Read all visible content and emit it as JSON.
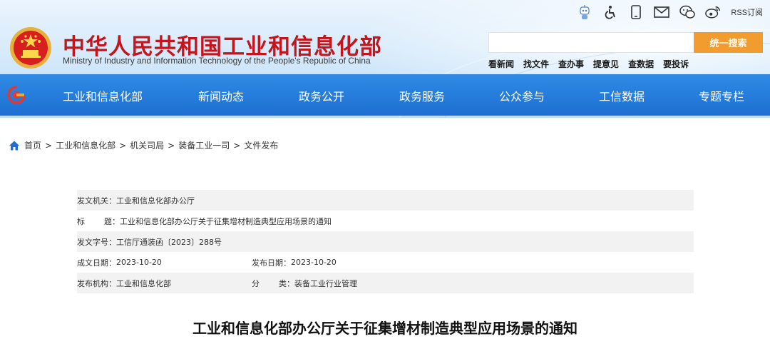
{
  "header": {
    "site_title": "中华人民共和国工业和信息化部",
    "site_subtitle": "Ministry of Industry and Information Technology of the People's Republic of China",
    "rss_label": "RSS订阅",
    "icons": [
      "robot-assistant-icon",
      "accessibility-icon",
      "mobile-icon",
      "mail-icon",
      "wechat-icon",
      "weibo-icon",
      "rss-icon"
    ],
    "search": {
      "placeholder": "",
      "button_label": "统一搜索"
    },
    "quick_links": [
      "看新闻",
      "找文件",
      "查办事",
      "提意见",
      "查数据",
      "要投诉"
    ]
  },
  "nav": {
    "items": [
      "工业和信息化部",
      "新闻动态",
      "政务公开",
      "政务服务",
      "公众参与",
      "工信数据",
      "专题专栏"
    ]
  },
  "breadcrumb": [
    "首页",
    "工业和信息化部",
    "机关司局",
    "装备工业一司",
    "文件发布"
  ],
  "meta": {
    "issuer_label": "发文机关：",
    "issuer_value": "工业和信息化部办公厅",
    "title_label_a": "标",
    "title_label_b": "题：",
    "title_value": "工业和信息化部办公厅关于征集增材制造典型应用场景的通知",
    "docno_label": "发文字号：",
    "docno_value": "工信厅通装函〔2023〕288号",
    "created_label": "成文日期：",
    "created_value": "2023-10-20",
    "published_label": "发布日期：",
    "published_value": "2023-10-20",
    "org_label": "发布机构：",
    "org_value": "工业和信息化部",
    "category_label_a": "分",
    "category_label_b": "类：",
    "category_value": "装备工业行业管理"
  },
  "document": {
    "title": "工业和信息化部办公厅关于征集增材制造典型应用场景的通知"
  },
  "colors": {
    "brand_red": "#c4151c",
    "nav_blue": "#1d6fd1",
    "search_orange": "#f29b2f"
  }
}
